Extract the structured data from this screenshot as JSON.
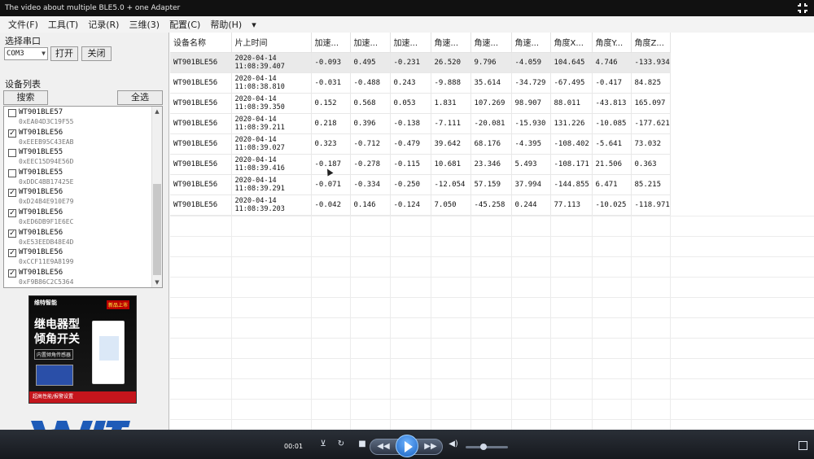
{
  "video": {
    "title": "The video about multiple BLE5.0 + one Adapter",
    "current_time": "00:01",
    "volume_level": 0.4
  },
  "menu": {
    "items": [
      "文件(F)",
      "工具(T)",
      "记录(R)",
      "三维(3)",
      "配置(C)",
      "帮助(H)"
    ],
    "more": "▾"
  },
  "serial": {
    "label": "选择串口",
    "port_value": "COM3",
    "open_label": "打开",
    "close_label": "关闭"
  },
  "devices": {
    "label": "设备列表",
    "search_label": "搜索",
    "select_all_label": "全选",
    "items": [
      {
        "name": "WT901BLE57",
        "mac": "0xEA04D3C19F55",
        "checked": false
      },
      {
        "name": "WT901BLE56",
        "mac": "0xEEEB95C43EAB",
        "checked": true
      },
      {
        "name": "WT901BLE55",
        "mac": "0xEEC15D94E56D",
        "checked": false
      },
      {
        "name": "WT901BLE55",
        "mac": "0xDDC4BB17425E",
        "checked": false
      },
      {
        "name": "WT901BLE56",
        "mac": "0xD24B4E910E79",
        "checked": true
      },
      {
        "name": "WT901BLE56",
        "mac": "0xED6DB9F1E6EC",
        "checked": true
      },
      {
        "name": "WT901BLE56",
        "mac": "0xE53EEDB48E4D",
        "checked": true
      },
      {
        "name": "WT901BLE56",
        "mac": "0xCCF11E9A8199",
        "checked": true
      },
      {
        "name": "WT901BLE56",
        "mac": "0xF9B86C2C5364",
        "checked": true
      }
    ]
  },
  "product": {
    "brand": "维特智能",
    "badge": "新品上市",
    "title_line1": "继电器型",
    "title_line2": "倾角开关",
    "subtitle": "内置倾角传感器",
    "footer": "超高性能/报警设置"
  },
  "table": {
    "headers": [
      "设备名称",
      "片上时间",
      "加速...",
      "加速...",
      "加速...",
      "角速...",
      "角速...",
      "角速...",
      "角度X...",
      "角度Y...",
      "角度Z..."
    ],
    "rows": [
      [
        "WT901BLE56",
        "2020-04-14",
        "11:08:39.407",
        "-0.093",
        "0.495",
        "-0.231",
        "26.520",
        "9.796",
        "-4.059",
        "104.645",
        "4.746",
        "-133.934"
      ],
      [
        "WT901BLE56",
        "2020-04-14",
        "11:08:38.810",
        "-0.031",
        "-0.488",
        "0.243",
        "-9.888",
        "35.614",
        "-34.729",
        "-67.495",
        "-0.417",
        "84.825"
      ],
      [
        "WT901BLE56",
        "2020-04-14",
        "11:08:39.350",
        "0.152",
        "0.568",
        "0.053",
        "1.831",
        "107.269",
        "98.907",
        "88.011",
        "-43.813",
        "165.097"
      ],
      [
        "WT901BLE56",
        "2020-04-14",
        "11:08:39.211",
        "0.218",
        "0.396",
        "-0.138",
        "-7.111",
        "-20.081",
        "-15.930",
        "131.226",
        "-10.085",
        "-177.621"
      ],
      [
        "WT901BLE56",
        "2020-04-14",
        "11:08:39.027",
        "0.323",
        "-0.712",
        "-0.479",
        "39.642",
        "68.176",
        "-4.395",
        "-108.402",
        "-5.641",
        "73.032"
      ],
      [
        "WT901BLE56",
        "2020-04-14",
        "11:08:39.416",
        "-0.187",
        "-0.278",
        "-0.115",
        "10.681",
        "23.346",
        "5.493",
        "-108.171",
        "21.506",
        "0.363"
      ],
      [
        "WT901BLE56",
        "2020-04-14",
        "11:08:39.291",
        "-0.071",
        "-0.334",
        "-0.250",
        "-12.054",
        "57.159",
        "37.994",
        "-144.855",
        "6.471",
        "85.215"
      ],
      [
        "WT901BLE56",
        "2020-04-14",
        "11:08:39.203",
        "-0.042",
        "0.146",
        "-0.124",
        "7.050",
        "-45.258",
        "0.244",
        "77.113",
        "-10.025",
        "-118.971"
      ]
    ]
  },
  "colors": {
    "title_bg": "#111111",
    "player_accent": "#1860c0",
    "brand_red": "#c4151c"
  }
}
